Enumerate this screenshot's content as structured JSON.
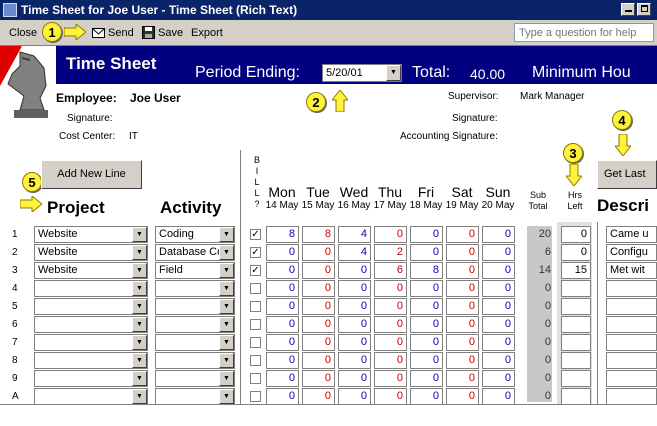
{
  "window": {
    "title": "Time Sheet for Joe User - Time Sheet (Rich Text)"
  },
  "toolbar": {
    "close": "Close",
    "send": "Send",
    "save": "Save",
    "export": "Export",
    "help_placeholder": "Type a question for help"
  },
  "callouts": [
    "1",
    "2",
    "3",
    "4",
    "5"
  ],
  "header": {
    "title": "Time Sheet",
    "period_label": "Period Ending:",
    "period_value": "5/20/01",
    "total_label": "Total:",
    "total_value": "40.00",
    "minimum_label": "Minimum Hou"
  },
  "info": {
    "employee_label": "Employee:",
    "employee_value": "Joe User",
    "signature_label": "Signature:",
    "cost_center_label": "Cost Center:",
    "cost_center_value": "IT",
    "supervisor_label": "Supervisor:",
    "supervisor_value": "Mark Manager",
    "sup_signature_label": "Signature:",
    "accounting_signature_label": "Accounting Signature:"
  },
  "buttons": {
    "add_new_line": "Add New Line",
    "get_last": "Get Last"
  },
  "columns": {
    "project": "Project",
    "activity": "Activity",
    "bill": [
      "B",
      "I",
      "L",
      "L",
      "?"
    ],
    "days": [
      {
        "day": "Mon",
        "date": "14 May"
      },
      {
        "day": "Tue",
        "date": "15 May"
      },
      {
        "day": "Wed",
        "date": "16 May"
      },
      {
        "day": "Thu",
        "date": "17 May"
      },
      {
        "day": "Fri",
        "date": "18 May"
      },
      {
        "day": "Sat",
        "date": "19 May"
      },
      {
        "day": "Sun",
        "date": "20 May"
      }
    ],
    "sub_total": [
      "Sub",
      "Total"
    ],
    "hrs_left": [
      "Hrs",
      "Left"
    ],
    "description": "Descri"
  },
  "rows": [
    {
      "num": "1",
      "project": "Website",
      "activity": "Coding",
      "billed": true,
      "hours": [
        "8",
        "8",
        "4",
        "0",
        "0",
        "0",
        "0"
      ],
      "subtotal": "20",
      "hrs_left": "0",
      "description": "Came u"
    },
    {
      "num": "2",
      "project": "Website",
      "activity": "Database Cor",
      "billed": true,
      "hours": [
        "0",
        "0",
        "4",
        "2",
        "0",
        "0",
        "0"
      ],
      "subtotal": "6",
      "hrs_left": "0",
      "description": "Configu"
    },
    {
      "num": "3",
      "project": "Website",
      "activity": "Field",
      "billed": true,
      "hours": [
        "0",
        "0",
        "0",
        "6",
        "8",
        "0",
        "0"
      ],
      "subtotal": "14",
      "hrs_left": "15",
      "description": "Met wit"
    },
    {
      "num": "4",
      "project": "",
      "activity": "",
      "billed": false,
      "hours": [
        "0",
        "0",
        "0",
        "0",
        "0",
        "0",
        "0"
      ],
      "subtotal": "0",
      "hrs_left": "",
      "description": ""
    },
    {
      "num": "5",
      "project": "",
      "activity": "",
      "billed": false,
      "hours": [
        "0",
        "0",
        "0",
        "0",
        "0",
        "0",
        "0"
      ],
      "subtotal": "0",
      "hrs_left": "",
      "description": ""
    },
    {
      "num": "6",
      "project": "",
      "activity": "",
      "billed": false,
      "hours": [
        "0",
        "0",
        "0",
        "0",
        "0",
        "0",
        "0"
      ],
      "subtotal": "0",
      "hrs_left": "",
      "description": ""
    },
    {
      "num": "7",
      "project": "",
      "activity": "",
      "billed": false,
      "hours": [
        "0",
        "0",
        "0",
        "0",
        "0",
        "0",
        "0"
      ],
      "subtotal": "0",
      "hrs_left": "",
      "description": ""
    },
    {
      "num": "8",
      "project": "",
      "activity": "",
      "billed": false,
      "hours": [
        "0",
        "0",
        "0",
        "0",
        "0",
        "0",
        "0"
      ],
      "subtotal": "0",
      "hrs_left": "",
      "description": ""
    },
    {
      "num": "9",
      "project": "",
      "activity": "",
      "billed": false,
      "hours": [
        "0",
        "0",
        "0",
        "0",
        "0",
        "0",
        "0"
      ],
      "subtotal": "0",
      "hrs_left": "",
      "description": ""
    },
    {
      "num": "A",
      "project": "",
      "activity": "",
      "billed": false,
      "hours": [
        "0",
        "0",
        "0",
        "0",
        "0",
        "0",
        "0"
      ],
      "subtotal": "0",
      "hrs_left": "",
      "description": ""
    }
  ],
  "colors": {
    "header_band": "#000080",
    "arrow": "#fff23a",
    "blue_value": "#0000cc",
    "red_value": "#cc0000"
  }
}
